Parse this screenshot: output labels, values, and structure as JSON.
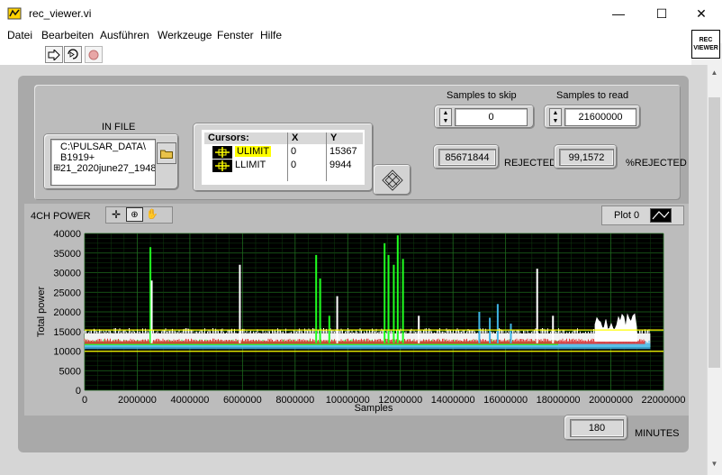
{
  "window": {
    "title": "rec_viewer.vi",
    "controls": {
      "minimize": "—",
      "maximize": "☐",
      "close": "✕"
    }
  },
  "menu": [
    "Datei",
    "Bearbeiten",
    "Ausführen",
    "Werkzeuge",
    "Fenster",
    "Hilfe"
  ],
  "toolbar": {
    "run_icon": "run-arrow-icon",
    "run_continuous_icon": "run-continuously-icon",
    "abort_icon": "abort-icon"
  },
  "vi_icon_text": "REC\nVIEWER",
  "in_file": {
    "label": "IN FILE",
    "path_lines": [
      "C:\\PULSAR_DATA\\",
      "B1919+",
      "21_2020june27_1948",
      "..."
    ],
    "browse_icon": "folder-icon"
  },
  "cursors": {
    "headers": [
      "Cursors:",
      "X",
      "Y"
    ],
    "rows": [
      {
        "name": "ULIMIT",
        "x": "0",
        "y": "15367",
        "color": "#ffff00"
      },
      {
        "name": "LLIMIT",
        "x": "0",
        "y": "9944",
        "color": "#ffff00"
      }
    ],
    "move_icon": "cursor-move-icon"
  },
  "samples_to_skip": {
    "label": "Samples to skip",
    "value": "0"
  },
  "samples_to_read": {
    "label": "Samples to read",
    "value": "21600000"
  },
  "rejected": {
    "value": "85671844",
    "label": "REJECTED"
  },
  "pct_rejected": {
    "value": "99,1572",
    "label": "%REJECTED"
  },
  "chart_title": "4CH POWER",
  "plot_legend": {
    "label": "Plot 0"
  },
  "minutes": {
    "value": "180",
    "label": "MINUTES"
  },
  "chart_data": {
    "type": "line",
    "title": "4CH POWER",
    "xlabel": "Samples",
    "ylabel": "Total power",
    "xlim": [
      0,
      22000000
    ],
    "ylim": [
      0,
      40000
    ],
    "x_ticks": [
      "0",
      "2000000",
      "4000000",
      "6000000",
      "8000000",
      "10000000",
      "12000000",
      "14000000",
      "16000000",
      "18000000",
      "20000000",
      "22000000"
    ],
    "y_ticks": [
      "0",
      "5000",
      "10000",
      "15000",
      "20000",
      "25000",
      "30000",
      "35000",
      "40000"
    ],
    "grid": true,
    "legend": "top-right",
    "cursors": [
      {
        "name": "ULIMIT",
        "y": 15367,
        "color": "#ffff00"
      },
      {
        "name": "LLIMIT",
        "y": 9944,
        "color": "#ffff00"
      }
    ],
    "series": [
      {
        "color": "#ffffff",
        "band": [
          11000,
          14500
        ],
        "end_x": 21500000
      },
      {
        "color": "#3fb6e6",
        "band": [
          10500,
          12000
        ],
        "end_x": 21500000
      },
      {
        "color": "#20ff20",
        "band": [
          11500,
          12300
        ],
        "end_x": 18000000
      },
      {
        "color": "#e03030",
        "band": [
          11800,
          12500
        ],
        "end_x": 21300000
      }
    ],
    "spikes": [
      {
        "x": 2500000,
        "y": 36500,
        "color": "#20ff20"
      },
      {
        "x": 2550000,
        "y": 28000,
        "color": "#ffffff"
      },
      {
        "x": 5900000,
        "y": 32000,
        "color": "#ffffff"
      },
      {
        "x": 8800000,
        "y": 34500,
        "color": "#20ff20"
      },
      {
        "x": 8950000,
        "y": 28500,
        "color": "#20ff20"
      },
      {
        "x": 9300000,
        "y": 19000,
        "color": "#20ff20"
      },
      {
        "x": 9600000,
        "y": 24000,
        "color": "#ffffff"
      },
      {
        "x": 11400000,
        "y": 37500,
        "color": "#20ff20"
      },
      {
        "x": 11550000,
        "y": 34500,
        "color": "#20ff20"
      },
      {
        "x": 11750000,
        "y": 32000,
        "color": "#20ff20"
      },
      {
        "x": 11900000,
        "y": 39500,
        "color": "#20ff20"
      },
      {
        "x": 12100000,
        "y": 33500,
        "color": "#20ff20"
      },
      {
        "x": 12700000,
        "y": 19000,
        "color": "#ffffff"
      },
      {
        "x": 15000000,
        "y": 20000,
        "color": "#3fb6e6"
      },
      {
        "x": 15400000,
        "y": 18500,
        "color": "#3fb6e6"
      },
      {
        "x": 15700000,
        "y": 22000,
        "color": "#3fb6e6"
      },
      {
        "x": 16200000,
        "y": 17000,
        "color": "#3fb6e6"
      },
      {
        "x": 17200000,
        "y": 31000,
        "color": "#ffffff"
      },
      {
        "x": 17800000,
        "y": 19000,
        "color": "#ffffff"
      }
    ],
    "bursts": [
      {
        "x0": 19400000,
        "x1": 21000000,
        "y": 19500,
        "color": "#ffffff"
      }
    ]
  }
}
